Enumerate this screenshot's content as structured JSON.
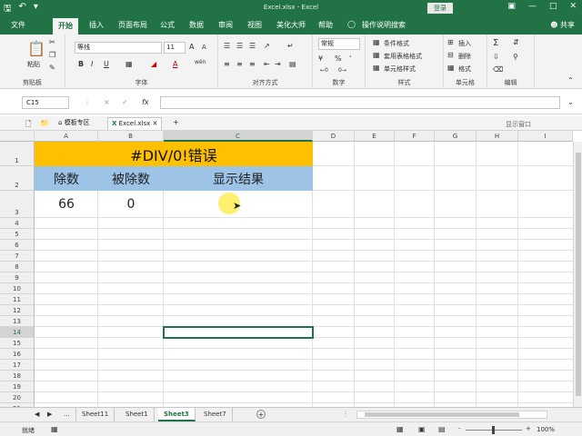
{
  "titlebar": {
    "title": "Excel.xlsx - Excel",
    "login": "登录",
    "qat": [
      "save-icon",
      "undo-icon",
      "customize-icon"
    ]
  },
  "tabs": {
    "items": [
      "文件",
      "开始",
      "插入",
      "页面布局",
      "公式",
      "数据",
      "审阅",
      "视图",
      "美化大师",
      "帮助"
    ],
    "active": "开始",
    "tell_me": "操作说明搜索",
    "share": "共享"
  },
  "ribbon": {
    "clipboard": {
      "label": "剪贴板",
      "paste": "粘贴"
    },
    "font": {
      "label": "字体",
      "font_name": "等线",
      "font_size": "11",
      "bold": "B",
      "italic": "I",
      "underline": "U",
      "grow": "A",
      "shrink": "A",
      "color_a": "A",
      "wen": "wén"
    },
    "alignment": {
      "label": "对齐方式"
    },
    "number": {
      "label": "数字",
      "format": "常规",
      "percent": "%"
    },
    "styles": {
      "label": "样式",
      "conditional": "条件格式",
      "table": "套用表格格式",
      "cell": "单元格样式"
    },
    "cells": {
      "label": "单元格",
      "insert": "插入",
      "delete": "删除",
      "format": "格式"
    },
    "editing": {
      "label": "编辑"
    }
  },
  "formula_bar": {
    "name_box": "C15",
    "fx": "fx",
    "cancel": "×",
    "confirm": "✓",
    "value": ""
  },
  "doc_tabs": {
    "template": "模板专区",
    "file": "Excel.xlsx",
    "add": "+",
    "show_window": "显示窗口"
  },
  "grid": {
    "columns": [
      "A",
      "B",
      "C",
      "D",
      "E",
      "F",
      "G",
      "H",
      "I"
    ],
    "rows": [
      "1",
      "2",
      "3",
      "4",
      "5",
      "6",
      "7",
      "8",
      "9",
      "10",
      "11",
      "12",
      "13",
      "14",
      "15",
      "16",
      "17",
      "18",
      "19",
      "20",
      "21"
    ],
    "title_cell": "#DIV/0!错误",
    "headers": [
      "除数",
      "被除数",
      "显示结果"
    ],
    "values": [
      "66",
      "0",
      ""
    ],
    "colors": {
      "title_bg": "#ffc000",
      "header_bg": "#9dc3e6",
      "accent": "#217346"
    }
  },
  "sheets": {
    "items": [
      "...",
      "Sheet11",
      "Sheet1",
      "Sheet3",
      "Sheet7"
    ],
    "active": "Sheet3",
    "add": "+"
  },
  "status": {
    "text": "就绪",
    "zoom": "100%",
    "minus": "-",
    "plus": "+"
  }
}
